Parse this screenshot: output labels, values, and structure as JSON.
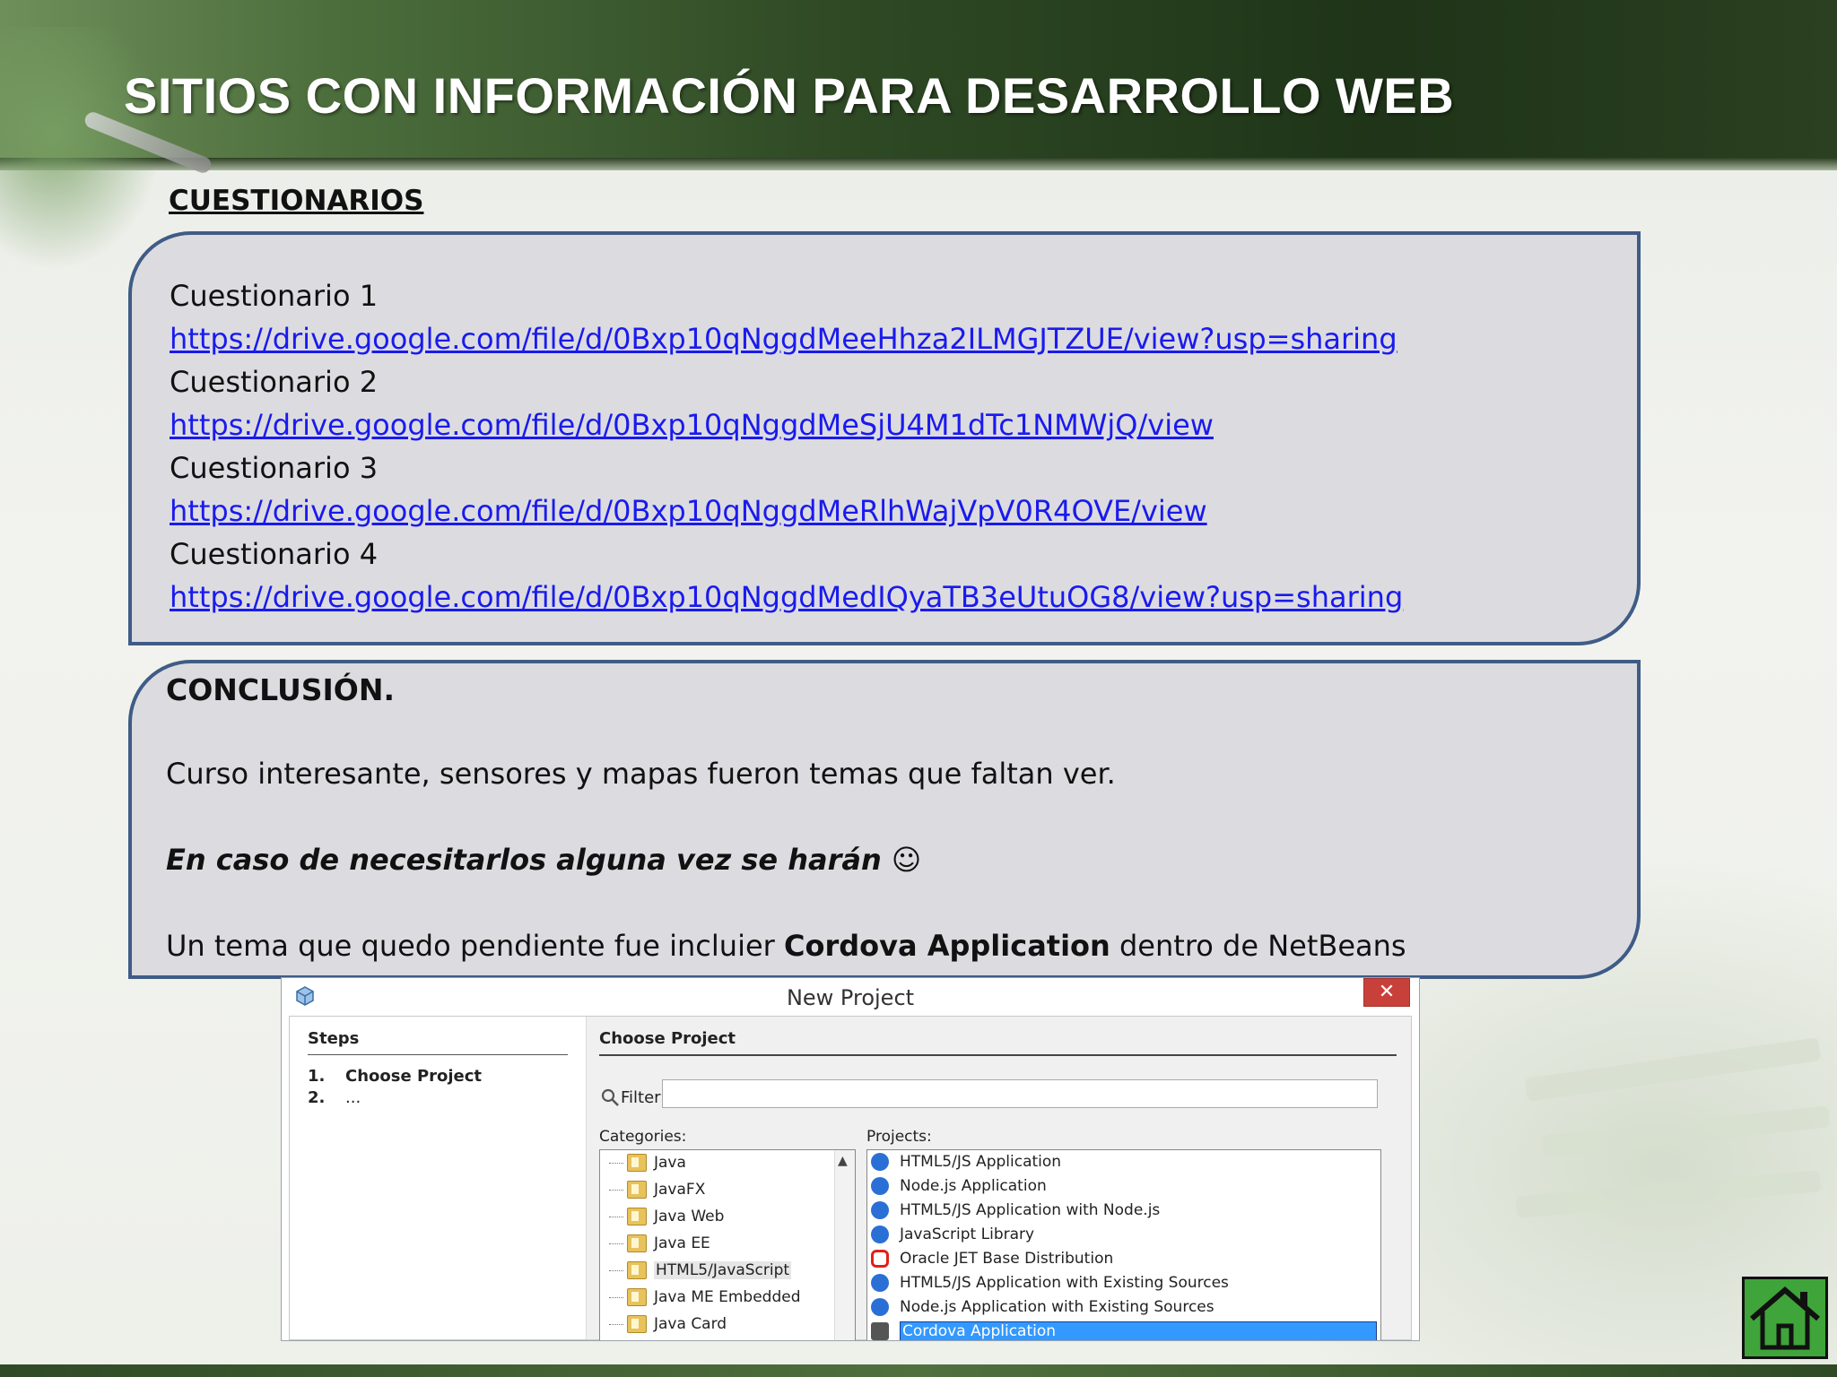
{
  "slide": {
    "title": "SITIOS CON INFORMACIÓN PARA DESARROLLO WEB",
    "section_heading": "CUESTIONARIOS",
    "quizzes": [
      {
        "label": "Cuestionario 1",
        "url": "https://drive.google.com/file/d/0Bxp10qNggdMeeHhza2ILMGJTZUE/view?usp=sharing"
      },
      {
        "label": "Cuestionario 2",
        "url": "https://drive.google.com/file/d/0Bxp10qNggdMeSjU4M1dTc1NMWjQ/view"
      },
      {
        "label": "Cuestionario 3",
        "url": "https://drive.google.com/file/d/0Bxp10qNggdMeRlhWajVpV0R4OVE/view"
      },
      {
        "label": "Cuestionario 4",
        "url": "https://drive.google.com/file/d/0Bxp10qNggdMedIQyaTB3eUtuOG8/view?usp=sharing"
      }
    ],
    "conclusion": {
      "heading": "CONCLUSIÓN.",
      "line1": "Curso interesante, sensores y mapas fueron temas que faltan ver.",
      "line2": "En caso de necesitarlos alguna vez se harán ☺",
      "line3_before": "Un tema que quedo pendiente fue incluier ",
      "line3_bold": "Cordova Application",
      "line3_after": " dentro de NetBeans"
    },
    "home_icon": "home-icon"
  },
  "dialog": {
    "title": "New Project",
    "close_label": "✕",
    "steps_heading": "Steps",
    "steps": [
      {
        "num": "1.",
        "label": "Choose Project"
      },
      {
        "num": "2.",
        "label": "..."
      }
    ],
    "choose_project_heading": "Choose Project",
    "filter_label": "Filter:",
    "filter_value": "",
    "categories_label": "Categories:",
    "projects_label": "Projects:",
    "categories": [
      "Java",
      "JavaFX",
      "Java Web",
      "Java EE",
      "HTML5/JavaScript",
      "Java ME Embedded",
      "Java Card"
    ],
    "selected_category": "HTML5/JavaScript",
    "projects": [
      {
        "label": "HTML5/JS Application",
        "icon_color": "#2a6fd6"
      },
      {
        "label": "Node.js Application",
        "icon_color": "#2a6fd6"
      },
      {
        "label": "HTML5/JS Application with Node.js",
        "icon_color": "#2a6fd6"
      },
      {
        "label": "JavaScript Library",
        "icon_color": "#2a6fd6"
      },
      {
        "label": "Oracle JET Base Distribution",
        "icon_color": "#e0201b"
      },
      {
        "label": "HTML5/JS Application with Existing Sources",
        "icon_color": "#2a6fd6"
      },
      {
        "label": "Node.js Application with Existing Sources",
        "icon_color": "#2a6fd6"
      },
      {
        "label": "Cordova Application",
        "icon_color": "#555555"
      }
    ],
    "selected_project": "Cordova Application"
  },
  "colors": {
    "box_border": "#3f5c86",
    "link": "#1a1aee",
    "home_button": "#3fa43a"
  }
}
